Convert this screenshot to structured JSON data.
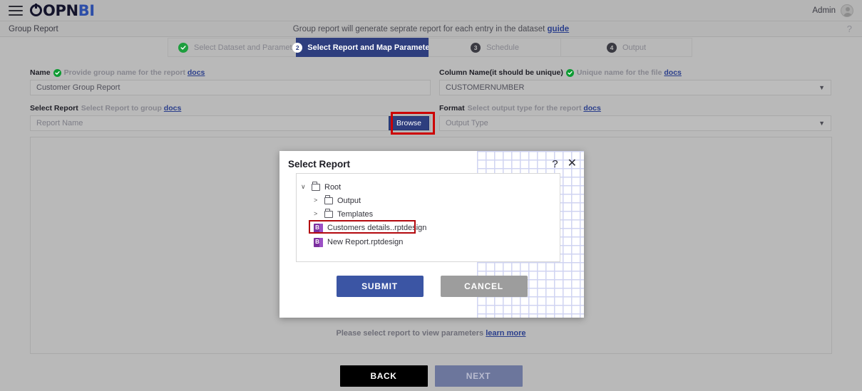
{
  "app": {
    "logo_dark": "OPN",
    "logo_blue": "BI",
    "admin_label": "Admin",
    "menu_icon": "hamburger-menu-icon",
    "avatar_icon": "user-avatar-icon"
  },
  "subheader": {
    "title": "Group Report",
    "description": "Group report will generate seprate report for each entry in the dataset",
    "description_link": "guide",
    "help": "?"
  },
  "stepper": {
    "steps": [
      {
        "num": "1",
        "label": "Select Dataset and Parameter",
        "state": "done"
      },
      {
        "num": "2",
        "label": "Select Report and Map Parameter",
        "state": "active"
      },
      {
        "num": "3",
        "label": "Schedule",
        "state": "pending"
      },
      {
        "num": "4",
        "label": "Output",
        "state": "pending"
      }
    ]
  },
  "form": {
    "name": {
      "label": "Name",
      "hint": "Provide group name for the report",
      "hint_link": "docs",
      "value": "Customer Group Report"
    },
    "select_report": {
      "label": "Select Report",
      "hint": "Select Report to group",
      "hint_link": "docs",
      "placeholder": "Report Name",
      "browse_label": "Browse"
    },
    "column_name": {
      "label": "Column Name(it should be unique)",
      "hint": "Unique name for the file",
      "hint_link": "docs",
      "value": "CUSTOMERNUMBER"
    },
    "format": {
      "label": "Format",
      "hint": "Select output type for the report",
      "hint_link": "docs",
      "placeholder": "Output Type"
    }
  },
  "panel": {
    "message": "Please select report to view parameters",
    "message_link": "learn more"
  },
  "footer": {
    "back_label": "BACK",
    "next_label": "NEXT"
  },
  "modal": {
    "title": "Select Report",
    "help_icon": "?",
    "close_icon": "✕",
    "tree": [
      {
        "label": "Root",
        "type": "folder",
        "level": 1,
        "expanded": true
      },
      {
        "label": "Output",
        "type": "folder",
        "level": 2,
        "expanded": false
      },
      {
        "label": "Templates",
        "type": "folder",
        "level": 2,
        "expanded": false
      },
      {
        "label": "Customers details..rptdesign",
        "type": "file",
        "level": 2,
        "highlighted": true
      },
      {
        "label": "New Report.rptdesign",
        "type": "file",
        "level": 2,
        "highlighted": false
      }
    ],
    "submit_label": "SUBMIT",
    "cancel_label": "CANCEL"
  },
  "colors": {
    "accent_navy": "#2e3e7e",
    "submit_blue": "#3b55a4",
    "cancel_gray": "#9d9d9d",
    "check_green": "#0e9b33",
    "highlight_red": "#cc0000",
    "link_blue": "#2b3f8c",
    "file_purple": "#7c2f9e"
  }
}
